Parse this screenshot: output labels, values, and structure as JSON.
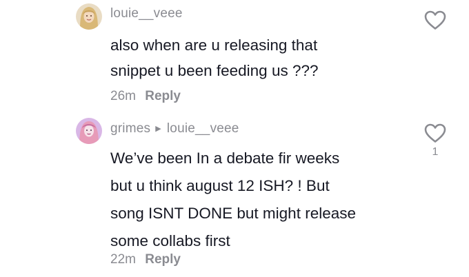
{
  "comments": [
    {
      "username": "louie__veee",
      "text": "also when are u releasing that\nsnippet u been feeding us ???",
      "timestamp": "26m",
      "reply_label": "Reply",
      "like_count": ""
    },
    {
      "username": "grimes",
      "reply_to": "louie__veee",
      "text": "We’ve been In a debate fir weeks\nbut u think august 12 ISH? ! But\nsong ISNT DONE but might release\nsome collabs first",
      "timestamp": "22m",
      "reply_label": "Reply",
      "like_count": "1"
    }
  ],
  "icons": {
    "like": "heart-outline-icon",
    "reply_arrow": "triangle-right-icon"
  },
  "colors": {
    "text": "#161823",
    "muted": "#8a8b91",
    "background": "#ffffff"
  }
}
